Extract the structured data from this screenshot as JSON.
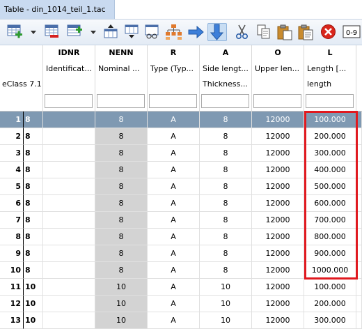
{
  "tab": {
    "title": "Table - din_1014_teil_1.tac"
  },
  "toolbar": {
    "buttons": [
      {
        "name": "add-rows-button",
        "icon": "table-add-icon"
      },
      {
        "name": "delete-rows-button",
        "icon": "table-remove-icon"
      },
      {
        "name": "insert-rows-button",
        "icon": "table-insert-icon"
      },
      {
        "name": "insert-above-button",
        "icon": "row-insert-above-icon"
      },
      {
        "name": "insert-below-button",
        "icon": "row-insert-below-icon"
      },
      {
        "name": "chart-button",
        "icon": "chart-icon"
      },
      {
        "name": "hierarchy-button",
        "icon": "hierarchy-icon"
      },
      {
        "name": "arrow-right-button",
        "icon": "arrow-right-icon"
      },
      {
        "name": "fill-down-button",
        "icon": "arrow-down-icon"
      },
      {
        "name": "cut-button",
        "icon": "scissors-icon"
      },
      {
        "name": "copy-button",
        "icon": "copy-icon"
      },
      {
        "name": "paste-button",
        "icon": "paste-icon"
      },
      {
        "name": "paste-special-button",
        "icon": "paste-special-icon"
      },
      {
        "name": "delete-button",
        "icon": "delete-icon"
      },
      {
        "name": "number-range-button",
        "icon": "number-range-icon",
        "label": "0-9"
      }
    ]
  },
  "columns": [
    {
      "code": "",
      "line1": "",
      "line2": "eClass 7.1"
    },
    {
      "code": "IDNR",
      "line1": "Identificat...",
      "line2": ""
    },
    {
      "code": "NENN",
      "line1": "Nominal ...",
      "line2": ""
    },
    {
      "code": "R",
      "line1": "Type (Typ...",
      "line2": ""
    },
    {
      "code": "A",
      "line1": "Side lengt...",
      "line2": "Thickness..."
    },
    {
      "code": "O",
      "line1": "Upper len...",
      "line2": ""
    },
    {
      "code": "L",
      "line1": "Length [...",
      "line2": "length"
    }
  ],
  "rows": [
    {
      "num": "1",
      "ec": "8",
      "idnr": "",
      "nenn": "8",
      "r": "A",
      "a": "8",
      "o": "12000",
      "l": "100.000",
      "selected": true
    },
    {
      "num": "2",
      "ec": "8",
      "idnr": "",
      "nenn": "8",
      "r": "A",
      "a": "8",
      "o": "12000",
      "l": "200.000"
    },
    {
      "num": "3",
      "ec": "8",
      "idnr": "",
      "nenn": "8",
      "r": "A",
      "a": "8",
      "o": "12000",
      "l": "300.000"
    },
    {
      "num": "4",
      "ec": "8",
      "idnr": "",
      "nenn": "8",
      "r": "A",
      "a": "8",
      "o": "12000",
      "l": "400.000"
    },
    {
      "num": "5",
      "ec": "8",
      "idnr": "",
      "nenn": "8",
      "r": "A",
      "a": "8",
      "o": "12000",
      "l": "500.000"
    },
    {
      "num": "6",
      "ec": "8",
      "idnr": "",
      "nenn": "8",
      "r": "A",
      "a": "8",
      "o": "12000",
      "l": "600.000"
    },
    {
      "num": "7",
      "ec": "8",
      "idnr": "",
      "nenn": "8",
      "r": "A",
      "a": "8",
      "o": "12000",
      "l": "700.000"
    },
    {
      "num": "8",
      "ec": "8",
      "idnr": "",
      "nenn": "8",
      "r": "A",
      "a": "8",
      "o": "12000",
      "l": "800.000"
    },
    {
      "num": "9",
      "ec": "8",
      "idnr": "",
      "nenn": "8",
      "r": "A",
      "a": "8",
      "o": "12000",
      "l": "900.000"
    },
    {
      "num": "10",
      "ec": "8",
      "idnr": "",
      "nenn": "8",
      "r": "A",
      "a": "8",
      "o": "12000",
      "l": "1000.000"
    },
    {
      "num": "11",
      "ec": "10",
      "idnr": "",
      "nenn": "10",
      "r": "A",
      "a": "10",
      "o": "12000",
      "l": "100.000"
    },
    {
      "num": "12",
      "ec": "10",
      "idnr": "",
      "nenn": "10",
      "r": "A",
      "a": "10",
      "o": "12000",
      "l": "200.000"
    },
    {
      "num": "13",
      "ec": "10",
      "idnr": "",
      "nenn": "10",
      "r": "A",
      "a": "10",
      "o": "12000",
      "l": "300.000"
    }
  ],
  "colors": {
    "selection": "#7f99b2",
    "highlight": "#e0191f",
    "nenn_column": "#d3d3d3"
  }
}
